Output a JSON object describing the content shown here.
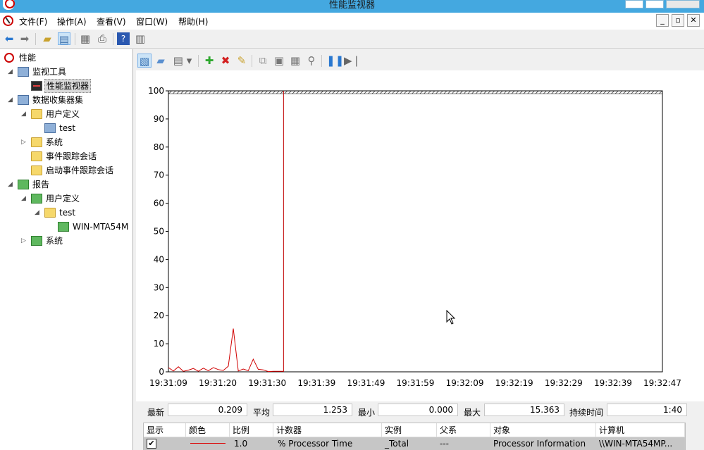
{
  "window": {
    "title": "性能监视器"
  },
  "menu": {
    "items": [
      "文件(F)",
      "操作(A)",
      "查看(V)",
      "窗口(W)",
      "帮助(H)"
    ]
  },
  "tree": {
    "items": [
      {
        "label": "性能",
        "icon": "perf-icon",
        "level": 0
      },
      {
        "label": "监视工具",
        "icon": "monitor-tools-icon",
        "level": 0
      },
      {
        "label": "性能监视器",
        "icon": "performance-monitor-icon",
        "level": 1
      },
      {
        "label": "数据收集器集",
        "icon": "data-collector-icon",
        "level": 0
      },
      {
        "label": "用户定义",
        "icon": "user-defined-icon",
        "level": 1
      },
      {
        "label": "test",
        "icon": "collector-set-icon",
        "level": 2
      },
      {
        "label": "系统",
        "icon": "system-icon",
        "level": 1
      },
      {
        "label": "事件跟踪会话",
        "icon": "event-trace-icon",
        "level": 1
      },
      {
        "label": "启动事件跟踪会话",
        "icon": "startup-trace-icon",
        "level": 1
      },
      {
        "label": "报告",
        "icon": "reports-icon",
        "level": 0
      },
      {
        "label": "用户定义",
        "icon": "user-defined-report-icon",
        "level": 1
      },
      {
        "label": "test",
        "icon": "report-folder-icon",
        "level": 2
      },
      {
        "label": "WIN-MTA54M",
        "icon": "report-item-icon",
        "level": 3
      },
      {
        "label": "系统",
        "icon": "system-report-icon",
        "level": 1
      }
    ]
  },
  "stats": {
    "last_label": "最新",
    "last_value": "0.209",
    "avg_label": "平均",
    "avg_value": "1.253",
    "min_label": "最小",
    "min_value": "0.000",
    "max_label": "最大",
    "max_value": "15.363",
    "duration_label": "持续时间",
    "duration_value": "1:40"
  },
  "counters": {
    "headers": {
      "show": "显示",
      "color": "颜色",
      "scale": "比例",
      "counter": "计数器",
      "instance": "实例",
      "parent": "父系",
      "object": "对象",
      "computer": "计算机"
    },
    "row": {
      "checked": "✔",
      "scale": "1.0",
      "counter": "% Processor Time",
      "instance": "_Total",
      "parent": "---",
      "object": "Processor Information",
      "computer": "\\\\WIN-MTA54MP..."
    }
  },
  "chart_data": {
    "type": "line",
    "title": "",
    "xlabel": "",
    "ylabel": "",
    "ylim": [
      0,
      100
    ],
    "yticks": [
      0,
      10,
      20,
      30,
      40,
      50,
      60,
      70,
      80,
      90,
      100
    ],
    "xticks": [
      "19:31:09",
      "19:31:20",
      "19:31:30",
      "19:31:39",
      "19:31:49",
      "19:31:59",
      "19:32:09",
      "19:32:19",
      "19:32:29",
      "19:32:39",
      "19:32:47"
    ],
    "grid": false,
    "series": [
      {
        "color": "#d00000",
        "sample_index": [
          0,
          1,
          2,
          3,
          4,
          5,
          6,
          7,
          8,
          9,
          10,
          11,
          12,
          13,
          14,
          15,
          16,
          17,
          18,
          19,
          20,
          21,
          22,
          23
        ],
        "values": [
          1.5,
          0.3,
          1.8,
          0.2,
          0.6,
          1.2,
          0.2,
          1.3,
          0.4,
          1.5,
          0.8,
          0.5,
          2.0,
          15.4,
          0.3,
          1.0,
          0.4,
          4.5,
          0.9,
          0.7,
          0.1,
          0.2,
          0.2,
          0.2
        ]
      }
    ],
    "time_bar_at_index": 23,
    "total_samples": 100,
    "hatch_top": true
  }
}
